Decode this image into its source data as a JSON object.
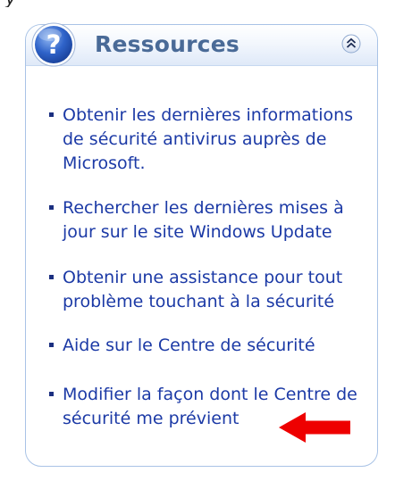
{
  "panel": {
    "title": "Ressources",
    "help_icon": "question-mark-icon",
    "collapse_icon": "double-chevron-up-icon",
    "links": [
      {
        "label": "Obtenir les dernières informations de sécurité antivirus auprès de Microsoft."
      },
      {
        "label": "Rechercher les dernières mises à jour sur le site Windows Update"
      },
      {
        "label": "Obtenir une assistance pour tout problème touchant à la sécurité"
      },
      {
        "label": "Aide sur le Centre de sécurité"
      },
      {
        "label": "Modifier la façon dont le Centre de sécurité me prévient"
      }
    ]
  },
  "colors": {
    "title": "#496a97",
    "link": "#1c3aa6",
    "bullet": "#1b2f80",
    "panel_border": "#a9c3e6",
    "arrow": "#ee0000"
  }
}
